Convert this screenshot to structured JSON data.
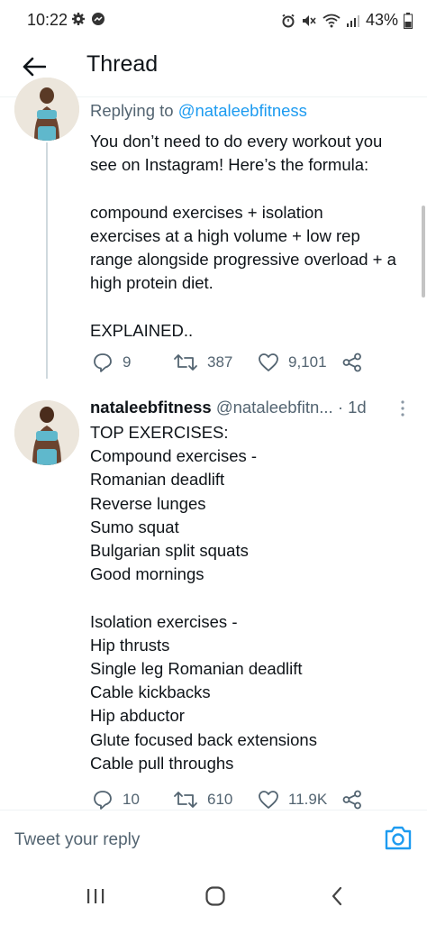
{
  "status_bar": {
    "time": "10:22",
    "battery": "43%",
    "icons": [
      "gear-icon",
      "messenger-icon",
      "alarm-icon",
      "mute-icon",
      "wifi-icon",
      "signal-icon",
      "battery-icon"
    ]
  },
  "header": {
    "title": "Thread",
    "back_icon": "arrow-left-icon"
  },
  "tweets": [
    {
      "replying_prefix": "Replying to ",
      "replying_handle": "@nataleebfitness",
      "text": "You don’t need to do every workout you\nsee on Instagram! Here’s the formula:\n\ncompound exercises + isolation\nexercises at a high volume + low rep\nrange alongside progressive overload + a\nhigh protein diet.\n\nEXPLAINED..",
      "replies": "9",
      "retweets": "387",
      "likes": "9,101"
    },
    {
      "name": "nataleebfitness",
      "handle": "@nataleebfitn...",
      "time": "· 1d",
      "text": "TOP EXERCISES:\nCompound exercises -\nRomanian deadlift\nReverse lunges\nSumo squat\nBulgarian split squats\nGood mornings\n\nIsolation exercises -\nHip thrusts\nSingle leg Romanian deadlift\nCable kickbacks\nHip abductor\nGlute focused back extensions\nCable pull throughs",
      "replies": "10",
      "retweets": "610",
      "likes": "11.9K"
    }
  ],
  "composer": {
    "placeholder": "Tweet your reply",
    "camera_icon": "camera-icon"
  },
  "navbar": {
    "icons": [
      "recent-apps-icon",
      "home-icon",
      "back-icon"
    ]
  },
  "colors": {
    "accent": "#1d9bf0",
    "secondary_text": "#536471",
    "primary_text": "#0f1419",
    "divider": "#eff3f4"
  }
}
